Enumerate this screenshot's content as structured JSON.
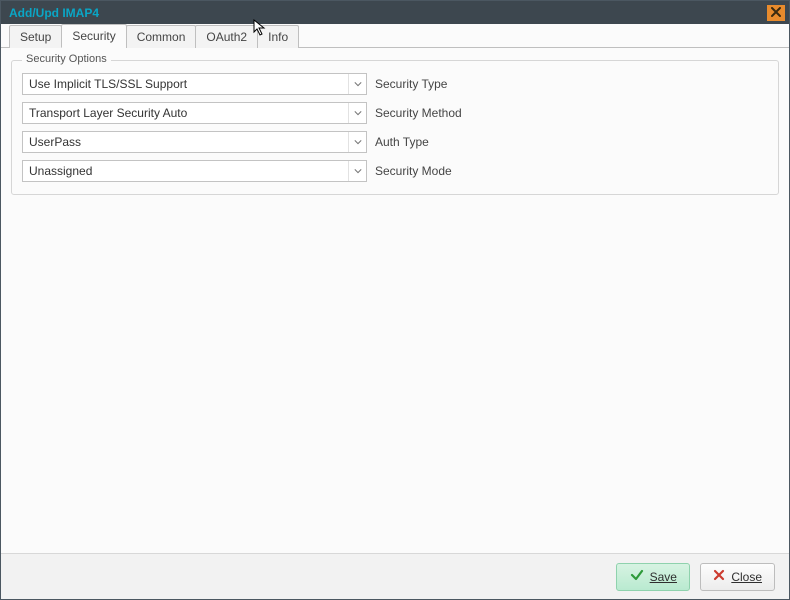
{
  "window": {
    "title": "Add/Upd IMAP4"
  },
  "tabs": [
    {
      "label": "Setup",
      "active": false
    },
    {
      "label": "Security",
      "active": true
    },
    {
      "label": "Common",
      "active": false
    },
    {
      "label": "OAuth2",
      "active": false
    },
    {
      "label": "Info",
      "active": false
    }
  ],
  "group": {
    "legend": "Security Options"
  },
  "fields": {
    "security_type": {
      "value": "Use Implicit TLS/SSL Support",
      "label": "Security Type"
    },
    "security_method": {
      "value": "Transport Layer Security Auto",
      "label": "Security Method"
    },
    "auth_type": {
      "value": "UserPass",
      "label": "Auth Type"
    },
    "security_mode": {
      "value": "Unassigned",
      "label": "Security Mode"
    }
  },
  "buttons": {
    "save": "Save",
    "close": "Close"
  }
}
